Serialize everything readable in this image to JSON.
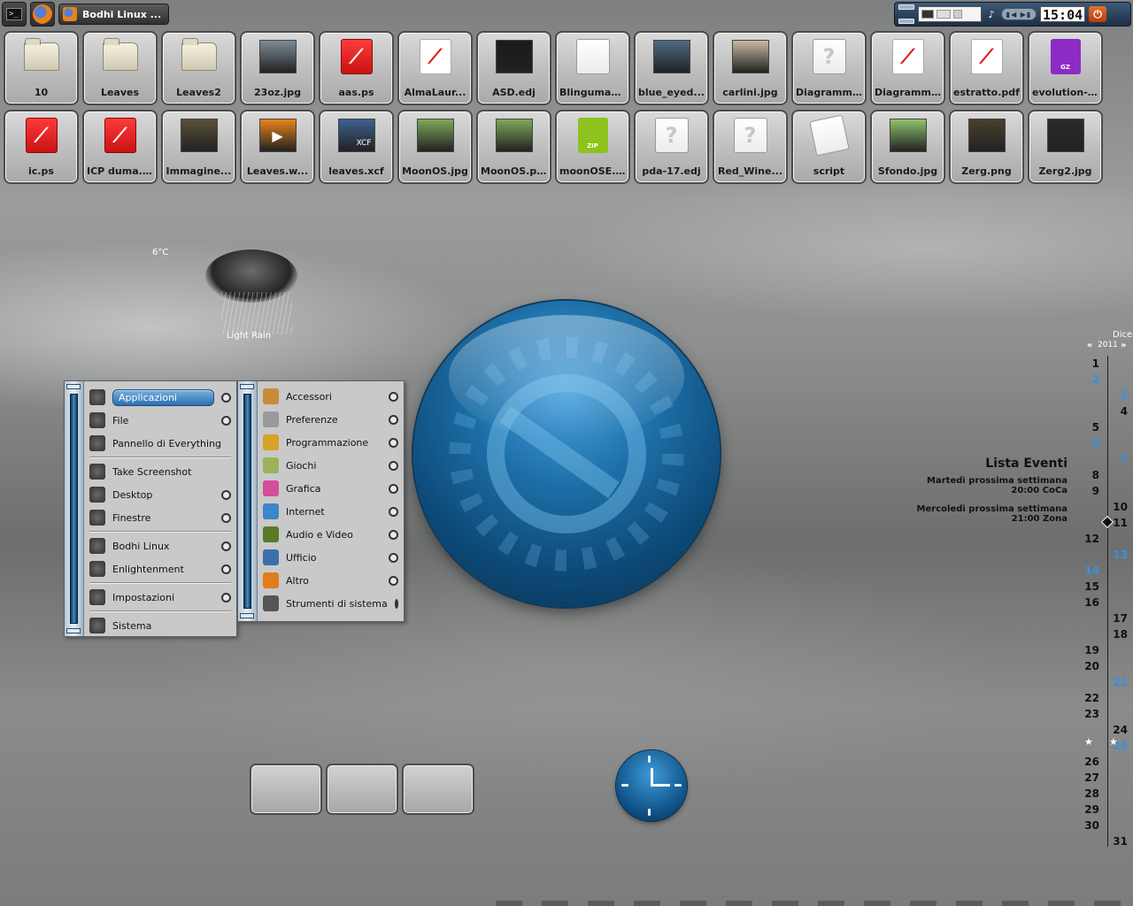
{
  "taskbar": {
    "terminal_glyph": ">_",
    "task_label": "Bodhi Linux ...",
    "clock_time": "15:04",
    "media_glyph": "▮◀ ▶▮"
  },
  "desktop_icons": [
    {
      "label": "10",
      "kind": "folder"
    },
    {
      "label": "Leaves",
      "kind": "folder"
    },
    {
      "label": "Leaves2",
      "kind": "folder"
    },
    {
      "label": "23oz.jpg",
      "kind": "image",
      "color": "#7d8a96"
    },
    {
      "label": "aas.ps",
      "kind": "pdf-red"
    },
    {
      "label": "AlmaLaur...",
      "kind": "pdf"
    },
    {
      "label": "ASD.edj",
      "kind": "image",
      "color": "#1a1a1a"
    },
    {
      "label": "BlingumaE...",
      "kind": "doc-blank"
    },
    {
      "label": "blue_eyed...",
      "kind": "image",
      "color": "#4f6a86"
    },
    {
      "label": "carlini.jpg",
      "kind": "image",
      "color": "#c9b9a0"
    },
    {
      "label": "Diagramm...",
      "kind": "doc"
    },
    {
      "label": "Diagramm...",
      "kind": "pdf"
    },
    {
      "label": "estratto.pdf",
      "kind": "pdf"
    },
    {
      "label": "evolution-...",
      "kind": "archive",
      "color": "#8d2cc4",
      "tag": "GZ"
    },
    {
      "label": "ic.ps",
      "kind": "pdf-red"
    },
    {
      "label": "ICP duma.ps",
      "kind": "pdf-red"
    },
    {
      "label": "Immagine...",
      "kind": "image",
      "color": "#5a5038"
    },
    {
      "label": "Leaves.w...",
      "kind": "video",
      "color": "#e8821c"
    },
    {
      "label": "leaves.xcf",
      "kind": "image",
      "color": "#3d5f8f",
      "tag": "XCF"
    },
    {
      "label": "MoonOS.jpg",
      "kind": "image",
      "color": "#7fa85a"
    },
    {
      "label": "MoonOS.png",
      "kind": "image",
      "color": "#7fa85a"
    },
    {
      "label": "moonOSE....",
      "kind": "archive",
      "color": "#8ec21d",
      "tag": "ZIP"
    },
    {
      "label": "pda-17.edj",
      "kind": "doc"
    },
    {
      "label": "Red_Wine...",
      "kind": "doc"
    },
    {
      "label": "script",
      "kind": "script"
    },
    {
      "label": "Sfondo.jpg",
      "kind": "image",
      "color": "#8fc46c"
    },
    {
      "label": "Zerg.png",
      "kind": "image",
      "color": "#4a3f2c"
    },
    {
      "label": "Zerg2.jpg",
      "kind": "image",
      "color": "#2b2b2b"
    }
  ],
  "weather": {
    "temperature": "6°C",
    "condition": "Light Rain"
  },
  "main_menu": {
    "items": [
      {
        "label": "Applicazioni",
        "icon": "gear-icon",
        "submenu": true,
        "active": true
      },
      {
        "label": "File",
        "icon": "file-icon",
        "submenu": true
      },
      {
        "label": "Pannello di Everything",
        "icon": "gear-icon",
        "submenu": false
      },
      {
        "label": "Take Screenshot",
        "icon": "camera-icon",
        "submenu": false
      },
      {
        "label": "Desktop",
        "icon": "desktop-icon",
        "submenu": true
      },
      {
        "label": "Finestre",
        "icon": "window-icon",
        "submenu": true
      },
      {
        "label": "Bodhi Linux",
        "icon": "bodhi-leaf-icon",
        "submenu": true
      },
      {
        "label": "Enlightenment",
        "icon": "enlightenment-icon",
        "submenu": true
      },
      {
        "label": "Impostazioni",
        "icon": "tools-icon",
        "submenu": true
      },
      {
        "label": "Sistema",
        "icon": "computer-icon",
        "submenu": false
      }
    ]
  },
  "apps_menu": {
    "items": [
      {
        "label": "Accessori",
        "icon": "accessories-icon",
        "color": "#c98a3a"
      },
      {
        "label": "Preferenze",
        "icon": "preferences-icon",
        "color": "#9a9a9a"
      },
      {
        "label": "Programmazione",
        "icon": "programming-icon",
        "color": "#d8a12a"
      },
      {
        "label": "Giochi",
        "icon": "games-icon",
        "color": "#9bb25c"
      },
      {
        "label": "Grafica",
        "icon": "graphics-icon",
        "color": "#d44d9a"
      },
      {
        "label": "Internet",
        "icon": "internet-icon",
        "color": "#3d85c9"
      },
      {
        "label": "Audio e Video",
        "icon": "audio-video-icon",
        "color": "#5a7a2a"
      },
      {
        "label": "Ufficio",
        "icon": "office-icon",
        "color": "#3c6fa8"
      },
      {
        "label": "Altro",
        "icon": "other-icon",
        "color": "#e07d1c"
      },
      {
        "label": "Strumenti di sistema",
        "icon": "system-tools-icon",
        "color": "#555555"
      }
    ]
  },
  "calendar": {
    "month": "Dicer",
    "year": "2011",
    "prev": "«",
    "next": "»",
    "days": [
      {
        "d": "1"
      },
      {
        "d": "2",
        "blue": true
      },
      {
        "d": "3",
        "blue": true
      },
      {
        "d": "4"
      },
      {
        "d": "5"
      },
      {
        "d": "6",
        "blue": true
      },
      {
        "d": "7",
        "blue": true
      },
      {
        "d": "8"
      },
      {
        "d": "9"
      },
      {
        "d": "10"
      },
      {
        "d": "11"
      },
      {
        "d": "12"
      },
      {
        "d": "13",
        "blue": true
      },
      {
        "d": "14",
        "blue": true
      },
      {
        "d": "15"
      },
      {
        "d": "16"
      },
      {
        "d": "17"
      },
      {
        "d": "18"
      },
      {
        "d": "19"
      },
      {
        "d": "20"
      },
      {
        "d": "21",
        "blue": true
      },
      {
        "d": "22"
      },
      {
        "d": "23"
      },
      {
        "d": "24"
      },
      {
        "d": "25",
        "blue": true
      },
      {
        "d": "26"
      },
      {
        "d": "27"
      },
      {
        "d": "28"
      },
      {
        "d": "29"
      },
      {
        "d": "30"
      },
      {
        "d": "31"
      }
    ],
    "current_day": "11"
  },
  "events": {
    "title": "Lista Eventi",
    "list": [
      {
        "day": "Martedì prossima settimana",
        "time": "20:00 CoCa"
      },
      {
        "day": "Mercoledì prossima settimana",
        "time": "21:00 Zona"
      }
    ]
  }
}
